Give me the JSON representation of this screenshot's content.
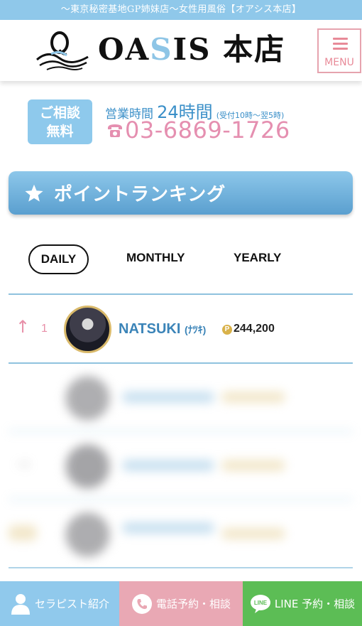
{
  "topbar": {
    "text": "〜東京秘密基地GP姉妹店〜女性用風俗【オアシス本店】"
  },
  "header": {
    "logo_prefix": "OA",
    "logo_s": "S",
    "logo_suffix": "IS 本店",
    "menu_label": "MENU"
  },
  "contact": {
    "consult_line1": "ご相談",
    "consult_line2": "無料",
    "hours_label": "営業時間",
    "hours_value": "24時間",
    "hours_note": "(受付10時〜翌5時)",
    "phone": "03-6869-1726"
  },
  "ranking": {
    "title": "ポイントランキング",
    "tabs": [
      "DAILY",
      "MONTHLY",
      "YEARLY"
    ],
    "active_tab": "DAILY",
    "rows": [
      {
        "arrow": "↑",
        "rank": "1",
        "name": "NATSUKI",
        "kana": "(ﾅﾂｷ)",
        "points": "244,200"
      }
    ]
  },
  "footer": {
    "therapist": "セラピスト紹介",
    "phone_reserve": "電話予約・相談",
    "line_reserve": "LINE 予約・相談"
  },
  "colors": {
    "accent_blue": "#8fc8ea",
    "pink": "#e88fa8",
    "line_green": "#5cbd55",
    "gold": "#d9b24a"
  },
  "icons": [
    "menu-icon",
    "phone-icon",
    "star-icon",
    "points-icon",
    "person-icon",
    "line-icon"
  ]
}
